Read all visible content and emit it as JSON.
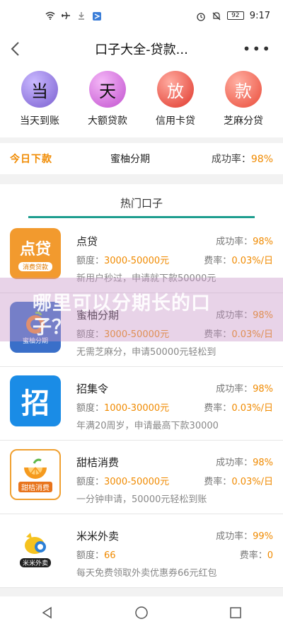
{
  "status_bar": {
    "time": "9:17",
    "battery": "92"
  },
  "header": {
    "title": "口子大全-贷款...",
    "more": "•••"
  },
  "quick_links": [
    {
      "char": "当",
      "label": "当天到账",
      "color": "#8a7bd8"
    },
    {
      "char": "天",
      "label": "大额贷款",
      "color": "#cf68d6"
    },
    {
      "char": "放",
      "label": "信用卡贷",
      "color": "#e84c3d"
    },
    {
      "char": "款",
      "label": "芝麻分贷",
      "color": "#f05b4a"
    }
  ],
  "ticker": {
    "badge": "今日下款",
    "name": "蜜柚分期",
    "rate_label": "成功率：",
    "rate_value": "98%"
  },
  "tab": {
    "label": "热门口子"
  },
  "items": [
    {
      "name": "点贷",
      "logo_text": "点贷",
      "logo_sub": "消费贷款",
      "rate_label": "成功率：",
      "rate_value": "98%",
      "amount_label": "额度：",
      "amount_value": "3000-50000元",
      "fee_label": "费率：",
      "fee_value": "0.03%/日",
      "desc": "新用户秒过，申请就下款50000元"
    },
    {
      "name": "蜜柚分期",
      "logo_text": "蜜柚分期",
      "logo_sub": "",
      "rate_label": "成功率：",
      "rate_value": "98%",
      "amount_label": "额度：",
      "amount_value": "3000-50000元",
      "fee_label": "费率：",
      "fee_value": "0.03%/日",
      "desc": "无需芝麻分，申请50000元轻松到"
    },
    {
      "name": "招集令",
      "logo_text": "招",
      "logo_sub": "",
      "rate_label": "成功率：",
      "rate_value": "98%",
      "amount_label": "额度：",
      "amount_value": "1000-30000元",
      "fee_label": "费率：",
      "fee_value": "0.03%/日",
      "desc": "年满20周岁，申请最高下款30000"
    },
    {
      "name": "甜桔消费",
      "logo_text": "甜桔消费",
      "logo_sub": "",
      "rate_label": "成功率：",
      "rate_value": "98%",
      "amount_label": "额度：",
      "amount_value": "3000-50000元",
      "fee_label": "费率：",
      "fee_value": "0.03%/日",
      "desc": "一分钟申请，50000元轻松到账"
    },
    {
      "name": "米米外卖",
      "logo_text": "米米外卖",
      "logo_sub": "",
      "rate_label": "成功率：",
      "rate_value": "99%",
      "amount_label": "额度：",
      "amount_value": "66",
      "fee_label": "费率：",
      "fee_value": "0",
      "desc": "每天免费领取外卖优惠券66元红包"
    }
  ],
  "overlay": {
    "line1": "哪里可以分期长的口",
    "line2": "子？"
  }
}
